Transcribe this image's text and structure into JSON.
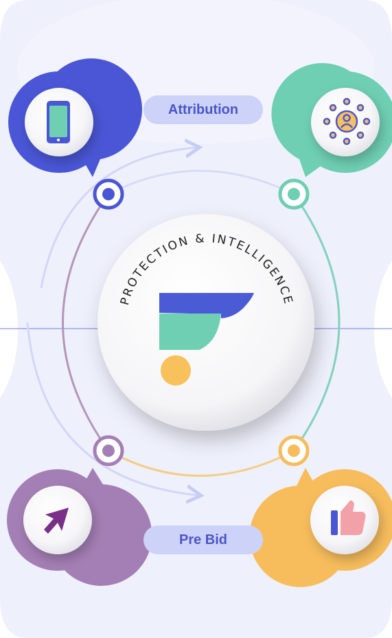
{
  "center": {
    "ring_text": "PROTECTION & INTELLIGENCE"
  },
  "labels": {
    "top": "Attribution",
    "bottom": "Pre Bid"
  },
  "nodes": [
    {
      "id": "top-left",
      "icon": "phone-icon",
      "color": "#4a56d6"
    },
    {
      "id": "top-right",
      "icon": "audience-icon",
      "color": "#6fcfb3"
    },
    {
      "id": "bottom-left",
      "icon": "cursor-arrow-icon",
      "color": "#a47fb5"
    },
    {
      "id": "bottom-right",
      "icon": "thumbs-up-icon",
      "color": "#f7bd5c"
    }
  ],
  "colors": {
    "background": "#eef0fc",
    "pill_bg": "#cdd3f8",
    "pill_text": "#4b55c9",
    "logo_blue": "#4b5bd6",
    "logo_green": "#6fcfb3",
    "logo_yellow": "#f8c15b"
  }
}
